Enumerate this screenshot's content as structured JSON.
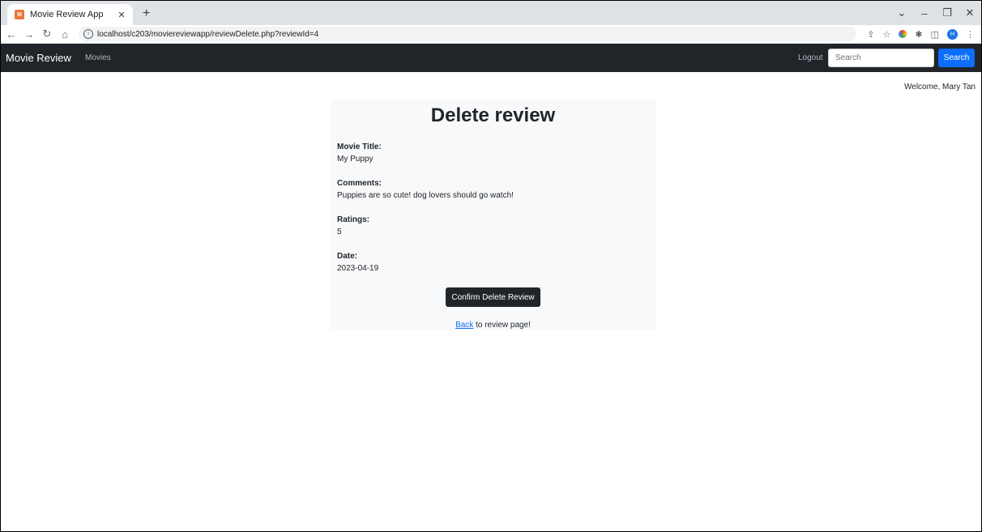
{
  "browser": {
    "tab_title": "Movie Review App",
    "favicon_text": "M",
    "url": "localhost/c203/moviereviewapp/reviewDelete.php?reviewId=4",
    "profile_initial": "H"
  },
  "navbar": {
    "brand": "Movie Review",
    "movies_link": "Movies",
    "logout_link": "Logout",
    "search_placeholder": "Search",
    "search_button": "Search"
  },
  "welcome": "Welcome, Mary Tan",
  "review": {
    "heading": "Delete review",
    "movie_title_label": "Movie Title:",
    "movie_title": "My Puppy",
    "comments_label": "Comments:",
    "comments": "Puppies are so cute! dog lovers should go watch!",
    "ratings_label": "Ratings:",
    "ratings": "5",
    "date_label": "Date:",
    "date": "2023-04-19",
    "confirm_button": "Confirm Delete Review",
    "back_link": "Back",
    "back_suffix": " to review page!"
  },
  "colors": {
    "navbar_bg": "#212529",
    "primary": "#0d6efd",
    "card_bg": "#f8f9fa"
  }
}
